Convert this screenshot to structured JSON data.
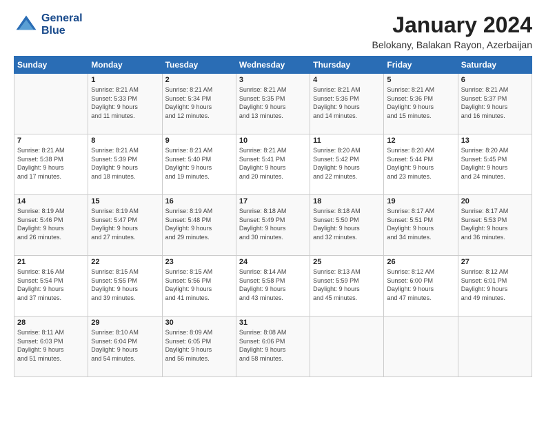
{
  "header": {
    "logo_line1": "General",
    "logo_line2": "Blue",
    "month": "January 2024",
    "location": "Belokany, Balakan Rayon, Azerbaijan"
  },
  "days_of_week": [
    "Sunday",
    "Monday",
    "Tuesday",
    "Wednesday",
    "Thursday",
    "Friday",
    "Saturday"
  ],
  "weeks": [
    [
      {
        "day": "",
        "info": ""
      },
      {
        "day": "1",
        "info": "Sunrise: 8:21 AM\nSunset: 5:33 PM\nDaylight: 9 hours\nand 11 minutes."
      },
      {
        "day": "2",
        "info": "Sunrise: 8:21 AM\nSunset: 5:34 PM\nDaylight: 9 hours\nand 12 minutes."
      },
      {
        "day": "3",
        "info": "Sunrise: 8:21 AM\nSunset: 5:35 PM\nDaylight: 9 hours\nand 13 minutes."
      },
      {
        "day": "4",
        "info": "Sunrise: 8:21 AM\nSunset: 5:36 PM\nDaylight: 9 hours\nand 14 minutes."
      },
      {
        "day": "5",
        "info": "Sunrise: 8:21 AM\nSunset: 5:36 PM\nDaylight: 9 hours\nand 15 minutes."
      },
      {
        "day": "6",
        "info": "Sunrise: 8:21 AM\nSunset: 5:37 PM\nDaylight: 9 hours\nand 16 minutes."
      }
    ],
    [
      {
        "day": "7",
        "info": "Sunrise: 8:21 AM\nSunset: 5:38 PM\nDaylight: 9 hours\nand 17 minutes."
      },
      {
        "day": "8",
        "info": "Sunrise: 8:21 AM\nSunset: 5:39 PM\nDaylight: 9 hours\nand 18 minutes."
      },
      {
        "day": "9",
        "info": "Sunrise: 8:21 AM\nSunset: 5:40 PM\nDaylight: 9 hours\nand 19 minutes."
      },
      {
        "day": "10",
        "info": "Sunrise: 8:21 AM\nSunset: 5:41 PM\nDaylight: 9 hours\nand 20 minutes."
      },
      {
        "day": "11",
        "info": "Sunrise: 8:20 AM\nSunset: 5:42 PM\nDaylight: 9 hours\nand 22 minutes."
      },
      {
        "day": "12",
        "info": "Sunrise: 8:20 AM\nSunset: 5:44 PM\nDaylight: 9 hours\nand 23 minutes."
      },
      {
        "day": "13",
        "info": "Sunrise: 8:20 AM\nSunset: 5:45 PM\nDaylight: 9 hours\nand 24 minutes."
      }
    ],
    [
      {
        "day": "14",
        "info": "Sunrise: 8:19 AM\nSunset: 5:46 PM\nDaylight: 9 hours\nand 26 minutes."
      },
      {
        "day": "15",
        "info": "Sunrise: 8:19 AM\nSunset: 5:47 PM\nDaylight: 9 hours\nand 27 minutes."
      },
      {
        "day": "16",
        "info": "Sunrise: 8:19 AM\nSunset: 5:48 PM\nDaylight: 9 hours\nand 29 minutes."
      },
      {
        "day": "17",
        "info": "Sunrise: 8:18 AM\nSunset: 5:49 PM\nDaylight: 9 hours\nand 30 minutes."
      },
      {
        "day": "18",
        "info": "Sunrise: 8:18 AM\nSunset: 5:50 PM\nDaylight: 9 hours\nand 32 minutes."
      },
      {
        "day": "19",
        "info": "Sunrise: 8:17 AM\nSunset: 5:51 PM\nDaylight: 9 hours\nand 34 minutes."
      },
      {
        "day": "20",
        "info": "Sunrise: 8:17 AM\nSunset: 5:53 PM\nDaylight: 9 hours\nand 36 minutes."
      }
    ],
    [
      {
        "day": "21",
        "info": "Sunrise: 8:16 AM\nSunset: 5:54 PM\nDaylight: 9 hours\nand 37 minutes."
      },
      {
        "day": "22",
        "info": "Sunrise: 8:15 AM\nSunset: 5:55 PM\nDaylight: 9 hours\nand 39 minutes."
      },
      {
        "day": "23",
        "info": "Sunrise: 8:15 AM\nSunset: 5:56 PM\nDaylight: 9 hours\nand 41 minutes."
      },
      {
        "day": "24",
        "info": "Sunrise: 8:14 AM\nSunset: 5:58 PM\nDaylight: 9 hours\nand 43 minutes."
      },
      {
        "day": "25",
        "info": "Sunrise: 8:13 AM\nSunset: 5:59 PM\nDaylight: 9 hours\nand 45 minutes."
      },
      {
        "day": "26",
        "info": "Sunrise: 8:12 AM\nSunset: 6:00 PM\nDaylight: 9 hours\nand 47 minutes."
      },
      {
        "day": "27",
        "info": "Sunrise: 8:12 AM\nSunset: 6:01 PM\nDaylight: 9 hours\nand 49 minutes."
      }
    ],
    [
      {
        "day": "28",
        "info": "Sunrise: 8:11 AM\nSunset: 6:03 PM\nDaylight: 9 hours\nand 51 minutes."
      },
      {
        "day": "29",
        "info": "Sunrise: 8:10 AM\nSunset: 6:04 PM\nDaylight: 9 hours\nand 54 minutes."
      },
      {
        "day": "30",
        "info": "Sunrise: 8:09 AM\nSunset: 6:05 PM\nDaylight: 9 hours\nand 56 minutes."
      },
      {
        "day": "31",
        "info": "Sunrise: 8:08 AM\nSunset: 6:06 PM\nDaylight: 9 hours\nand 58 minutes."
      },
      {
        "day": "",
        "info": ""
      },
      {
        "day": "",
        "info": ""
      },
      {
        "day": "",
        "info": ""
      }
    ]
  ]
}
